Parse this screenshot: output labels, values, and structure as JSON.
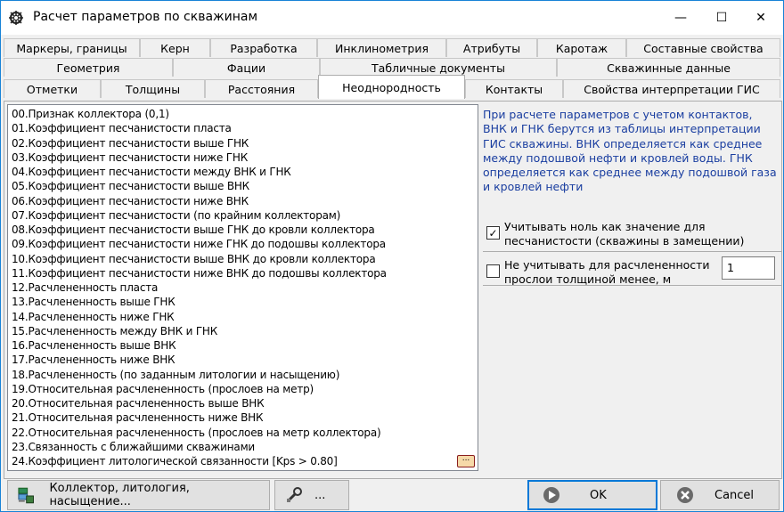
{
  "window": {
    "title": "Расчет параметров по скважинам",
    "controls": {
      "minimize": "—",
      "maximize": "☐",
      "close": "✕"
    }
  },
  "tabs": {
    "row1": [
      "Маркеры, границы",
      "Керн",
      "Разработка",
      "Инклинометрия",
      "Атрибуты",
      "Каротаж",
      "Составные свойства"
    ],
    "row2": [
      "Геометрия",
      "Фации",
      "Табличные документы",
      "Скважинные данные"
    ],
    "row3": [
      "Отметки",
      "Толщины",
      "Расстояния",
      "Неоднородность",
      "Контакты",
      "Свойства интерпретации ГИС"
    ],
    "active": "Неоднородность"
  },
  "params": [
    "00.Признак коллектора (0,1)",
    "01.Коэффициент песчанистости пласта",
    "02.Коэффициент песчанистости выше ГНК",
    "03.Коэффициент песчанистости ниже ГНК",
    "04.Коэффициент песчанистости между ВНК и ГНК",
    "05.Коэффициент песчанистости выше ВНК",
    "06.Коэффициент песчанистости ниже ВНК",
    "07.Коэффициент песчанистости (по крайним коллекторам)",
    "08.Коэффициент песчанистости выше ГНК до кровли коллектора",
    "09.Коэффициент песчанистости ниже ГНК до подошвы коллектора",
    "10.Коэффициент песчанистости выше ВНК до кровли коллектора",
    "11.Коэффициент песчанистости ниже ВНК до подошвы коллектора",
    "12.Расчлененность пласта",
    "13.Расчлененность выше ГНК",
    "14.Расчлененность ниже ГНК",
    "15.Расчлененность между ВНК и ГНК",
    "16.Расчлененность выше ВНК",
    "17.Расчлененность ниже ВНК",
    "18.Расчлененность (по заданным литологии и насыщению)",
    "19.Относительная расчлененность (прослоев на метр)",
    "20.Относительная расчлененность выше ВНК",
    "21.Относительная расчлененность ниже ВНК",
    "22.Относительная расчлененность (прослоев на метр коллектора)",
    "23.Связанность с ближайшими скважинами",
    "24.Коэффициент литологической связанности [Kps > 0.80]"
  ],
  "ellipsis_label": "...",
  "info": "При расчете параметров с учетом контактов, ВНК и ГНК берутся из таблицы интерпретации ГИС скважины. ВНК определяется как среднее между подошвой нефти и кровлей воды. ГНК определяется как среднее между подошвой газа и кровлей нефти",
  "options": {
    "zero_as_value": {
      "label_line1": "Учитывать ноль как значение для",
      "label_line2": "песчанистости (скважины в замещении)",
      "checked": true,
      "mark": "✓"
    },
    "ignore_thin": {
      "label_line1": "Не учитывать для расчлененности",
      "label_line2": "прослои толщиной менее, м",
      "checked": false,
      "value": "1"
    }
  },
  "buttons": {
    "collector": "Коллектор, литология, насыщение...",
    "tools": "...",
    "ok": "OK",
    "cancel": "Cancel"
  },
  "colors": {
    "info_text": "#1a3ea0",
    "accent": "#0078d7"
  }
}
